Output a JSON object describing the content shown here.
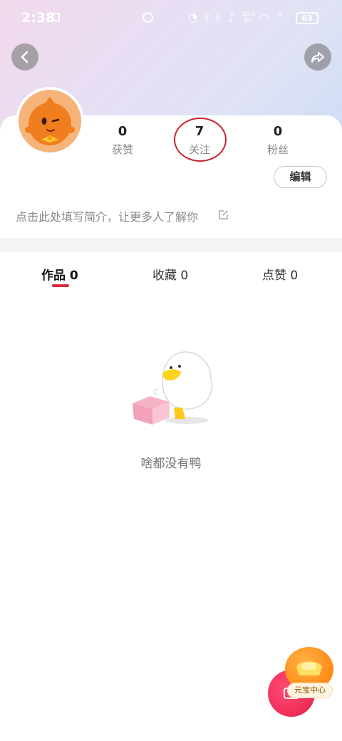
{
  "status_bar": {
    "time": "2:38",
    "network_speed": "29.5",
    "network_speed_unit": "K/s",
    "battery": "63"
  },
  "profile": {
    "stats": [
      {
        "value": "0",
        "label": "获赞"
      },
      {
        "value": "7",
        "label": "关注"
      },
      {
        "value": "0",
        "label": "粉丝"
      }
    ],
    "edit_label": "编辑",
    "bio_placeholder": "点击此处填写简介，让更多人了解你"
  },
  "tabs": [
    {
      "label": "作品 0",
      "active": true
    },
    {
      "label": "收藏 0",
      "active": false
    },
    {
      "label": "点赞 0",
      "active": false
    }
  ],
  "empty_state": {
    "message": "啥都没有鸭"
  },
  "floating": {
    "ingot_label": "元宝中心"
  },
  "colors": {
    "accent_red": "#e1253a",
    "highlight_ring": "#c9232c",
    "ingot_orange": "#ff7a00"
  }
}
